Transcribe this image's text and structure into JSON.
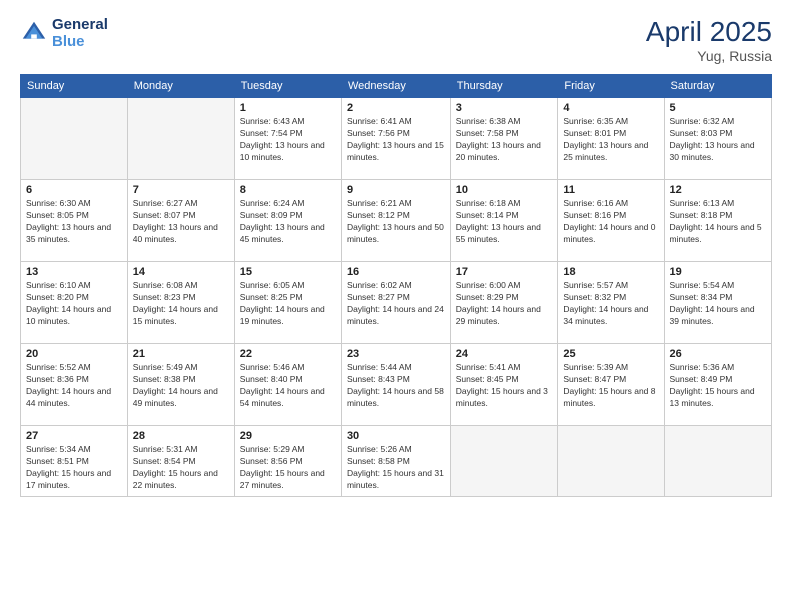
{
  "header": {
    "logo_line1": "General",
    "logo_line2": "Blue",
    "title": "April 2025",
    "location": "Yug, Russia"
  },
  "weekdays": [
    "Sunday",
    "Monday",
    "Tuesday",
    "Wednesday",
    "Thursday",
    "Friday",
    "Saturday"
  ],
  "weeks": [
    [
      {
        "day": "",
        "info": ""
      },
      {
        "day": "",
        "info": ""
      },
      {
        "day": "1",
        "info": "Sunrise: 6:43 AM\nSunset: 7:54 PM\nDaylight: 13 hours and 10 minutes."
      },
      {
        "day": "2",
        "info": "Sunrise: 6:41 AM\nSunset: 7:56 PM\nDaylight: 13 hours and 15 minutes."
      },
      {
        "day": "3",
        "info": "Sunrise: 6:38 AM\nSunset: 7:58 PM\nDaylight: 13 hours and 20 minutes."
      },
      {
        "day": "4",
        "info": "Sunrise: 6:35 AM\nSunset: 8:01 PM\nDaylight: 13 hours and 25 minutes."
      },
      {
        "day": "5",
        "info": "Sunrise: 6:32 AM\nSunset: 8:03 PM\nDaylight: 13 hours and 30 minutes."
      }
    ],
    [
      {
        "day": "6",
        "info": "Sunrise: 6:30 AM\nSunset: 8:05 PM\nDaylight: 13 hours and 35 minutes."
      },
      {
        "day": "7",
        "info": "Sunrise: 6:27 AM\nSunset: 8:07 PM\nDaylight: 13 hours and 40 minutes."
      },
      {
        "day": "8",
        "info": "Sunrise: 6:24 AM\nSunset: 8:09 PM\nDaylight: 13 hours and 45 minutes."
      },
      {
        "day": "9",
        "info": "Sunrise: 6:21 AM\nSunset: 8:12 PM\nDaylight: 13 hours and 50 minutes."
      },
      {
        "day": "10",
        "info": "Sunrise: 6:18 AM\nSunset: 8:14 PM\nDaylight: 13 hours and 55 minutes."
      },
      {
        "day": "11",
        "info": "Sunrise: 6:16 AM\nSunset: 8:16 PM\nDaylight: 14 hours and 0 minutes."
      },
      {
        "day": "12",
        "info": "Sunrise: 6:13 AM\nSunset: 8:18 PM\nDaylight: 14 hours and 5 minutes."
      }
    ],
    [
      {
        "day": "13",
        "info": "Sunrise: 6:10 AM\nSunset: 8:20 PM\nDaylight: 14 hours and 10 minutes."
      },
      {
        "day": "14",
        "info": "Sunrise: 6:08 AM\nSunset: 8:23 PM\nDaylight: 14 hours and 15 minutes."
      },
      {
        "day": "15",
        "info": "Sunrise: 6:05 AM\nSunset: 8:25 PM\nDaylight: 14 hours and 19 minutes."
      },
      {
        "day": "16",
        "info": "Sunrise: 6:02 AM\nSunset: 8:27 PM\nDaylight: 14 hours and 24 minutes."
      },
      {
        "day": "17",
        "info": "Sunrise: 6:00 AM\nSunset: 8:29 PM\nDaylight: 14 hours and 29 minutes."
      },
      {
        "day": "18",
        "info": "Sunrise: 5:57 AM\nSunset: 8:32 PM\nDaylight: 14 hours and 34 minutes."
      },
      {
        "day": "19",
        "info": "Sunrise: 5:54 AM\nSunset: 8:34 PM\nDaylight: 14 hours and 39 minutes."
      }
    ],
    [
      {
        "day": "20",
        "info": "Sunrise: 5:52 AM\nSunset: 8:36 PM\nDaylight: 14 hours and 44 minutes."
      },
      {
        "day": "21",
        "info": "Sunrise: 5:49 AM\nSunset: 8:38 PM\nDaylight: 14 hours and 49 minutes."
      },
      {
        "day": "22",
        "info": "Sunrise: 5:46 AM\nSunset: 8:40 PM\nDaylight: 14 hours and 54 minutes."
      },
      {
        "day": "23",
        "info": "Sunrise: 5:44 AM\nSunset: 8:43 PM\nDaylight: 14 hours and 58 minutes."
      },
      {
        "day": "24",
        "info": "Sunrise: 5:41 AM\nSunset: 8:45 PM\nDaylight: 15 hours and 3 minutes."
      },
      {
        "day": "25",
        "info": "Sunrise: 5:39 AM\nSunset: 8:47 PM\nDaylight: 15 hours and 8 minutes."
      },
      {
        "day": "26",
        "info": "Sunrise: 5:36 AM\nSunset: 8:49 PM\nDaylight: 15 hours and 13 minutes."
      }
    ],
    [
      {
        "day": "27",
        "info": "Sunrise: 5:34 AM\nSunset: 8:51 PM\nDaylight: 15 hours and 17 minutes."
      },
      {
        "day": "28",
        "info": "Sunrise: 5:31 AM\nSunset: 8:54 PM\nDaylight: 15 hours and 22 minutes."
      },
      {
        "day": "29",
        "info": "Sunrise: 5:29 AM\nSunset: 8:56 PM\nDaylight: 15 hours and 27 minutes."
      },
      {
        "day": "30",
        "info": "Sunrise: 5:26 AM\nSunset: 8:58 PM\nDaylight: 15 hours and 31 minutes."
      },
      {
        "day": "",
        "info": ""
      },
      {
        "day": "",
        "info": ""
      },
      {
        "day": "",
        "info": ""
      }
    ]
  ]
}
